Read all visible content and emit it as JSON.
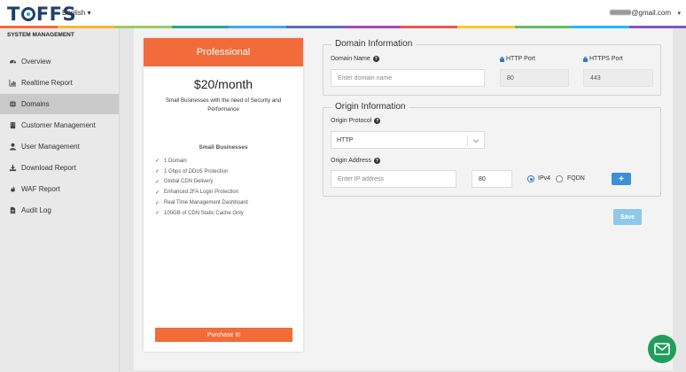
{
  "brand": {
    "logo_text": "TOFFS"
  },
  "header": {
    "language": "English ▾",
    "user_email_visible": "@gmail.com",
    "user_menu_caret": "▾",
    "stripe_colors": [
      "#f26b3a",
      "#f7b731",
      "#9ccc65",
      "#26a69a",
      "#42a5f5",
      "#5c6bc0",
      "#ab47bc",
      "#ef5350",
      "#ffca28",
      "#66bb6a",
      "#29b6f6",
      "#7e57c2"
    ]
  },
  "sidebar": {
    "title": "SYSTEM MANAGEMENT",
    "items": [
      {
        "label": "Overview",
        "icon": "dashboard-icon",
        "active": false
      },
      {
        "label": "Realtime Report",
        "icon": "chart-icon",
        "active": false
      },
      {
        "label": "Domains",
        "icon": "globe-icon",
        "active": true
      },
      {
        "label": "Customer Management",
        "icon": "building-icon",
        "active": false
      },
      {
        "label": "User Management",
        "icon": "user-icon",
        "active": false
      },
      {
        "label": "Download Report",
        "icon": "download-icon",
        "active": false
      },
      {
        "label": "WAF Report",
        "icon": "fire-icon",
        "active": false
      },
      {
        "label": "Audit Log",
        "icon": "file-icon",
        "active": false
      }
    ]
  },
  "plan": {
    "name": "Professional",
    "price": "$20/month",
    "description": "Small Businesses with the need of Security and Performance",
    "features_title": "Small Businesses",
    "features": [
      "1 Domain",
      "1 Gbps of DDoS Protection",
      "Global CDN Delivery",
      "Enhanced 2FA Login Protection",
      "Real Time Management Dashboard",
      "100GB of CDN Static Cache Only"
    ],
    "purchase_label": "Purchase It!",
    "accent": "#f26b3a"
  },
  "domain_info": {
    "legend": "Domain Information",
    "domain_name_label": "Domain Name",
    "domain_name_placeholder": "Enter domain name",
    "http_port_label": "HTTP Port",
    "http_port_value": "80",
    "https_port_label": "HTTPS Port",
    "https_port_value": "443"
  },
  "origin_info": {
    "legend": "Origin Information",
    "protocol_label": "Origin Protocol",
    "protocol_value": "HTTP",
    "address_label": "Origin Address",
    "address_placeholder": "Enter IP address",
    "port_value": "80",
    "ipv4_label": "IPv4",
    "fqdn_label": "FQDN",
    "selected": "IPv4",
    "add_label": "+"
  },
  "save_label": "Save"
}
